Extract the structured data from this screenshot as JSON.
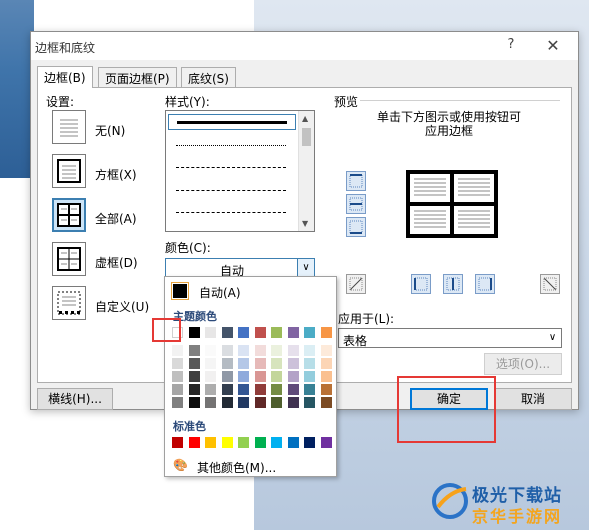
{
  "dialog": {
    "title": "边框和底纹",
    "help": "?",
    "close": "✕",
    "tabs": [
      {
        "label": "边框(B)",
        "active": true
      },
      {
        "label": "页面边框(P)",
        "active": false
      },
      {
        "label": "底纹(S)",
        "active": false
      }
    ]
  },
  "settings": {
    "label": "设置:",
    "items": [
      {
        "label": "无(N)"
      },
      {
        "label": "方框(X)"
      },
      {
        "label": "全部(A)",
        "selected": true
      },
      {
        "label": "虚框(D)"
      },
      {
        "label": "自定义(U)"
      }
    ]
  },
  "style": {
    "label": "样式(Y):",
    "color_label": "颜色(C):",
    "color_value": "自动"
  },
  "preview": {
    "label": "预览",
    "hint_line1": "单击下方图示或使用按钮可",
    "hint_line2": "应用边框"
  },
  "apply": {
    "label": "应用于(L):",
    "value": "表格"
  },
  "buttons": {
    "options": "选项(O)...",
    "horizontal_line": "横线(H)...",
    "ok": "确定",
    "cancel": "取消"
  },
  "color_popup": {
    "auto_label": "自动(A)",
    "theme_heading": "主题颜色",
    "standard_heading": "标准色",
    "more_colors": "其他颜色(M)...",
    "theme_top": [
      "#ffffff",
      "#000000",
      "#e7e6e6",
      "#44546a",
      "#4472c4",
      "#ed7d31",
      "#a5a5a5",
      "#ffc000",
      "#5b9bd5",
      "#70ad47"
    ],
    "theme_top_wps": [
      "#ffffff",
      "#000000",
      "#e7e6e6",
      "#44546a",
      "#4472c4",
      "#c0504d",
      "#9bbb59",
      "#8064a2",
      "#4bacc6",
      "#f79646"
    ],
    "standard": [
      "#c00000",
      "#ff0000",
      "#ffc000",
      "#ffff00",
      "#92d050",
      "#00b050",
      "#00b0f0",
      "#0070c0",
      "#002060",
      "#7030a0"
    ]
  },
  "watermark": {
    "line1": "极光下载站",
    "line2": "京华手游网"
  },
  "colors": {
    "accent": "#3c7fb1",
    "annotation": "#e53935"
  }
}
